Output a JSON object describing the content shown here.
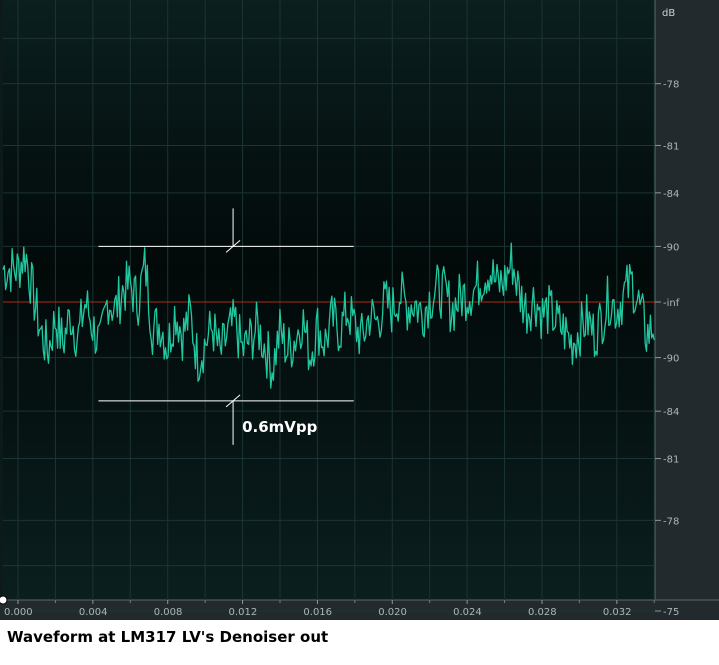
{
  "caption": "Waveform at LM317 LV's Denoiser out",
  "colors": {
    "background_top": "#071616",
    "background_mid": "#020808",
    "grid": "#1c3434",
    "waveform": "#20c8a0",
    "center_line": "#b02818",
    "annotation": "#ffffff",
    "tick_text": "#a8b8b8"
  },
  "chart_data": {
    "type": "line",
    "title": "",
    "xlabel": "",
    "ylabel": "",
    "x_unit": "s",
    "y_unit": "dB",
    "xlim": [
      0,
      0.0342
    ],
    "x_ticks": [
      0.0,
      0.004,
      0.008,
      0.012,
      0.016,
      0.02,
      0.024,
      0.028,
      0.032
    ],
    "x_tick_labels": [
      "0.000",
      "0.004",
      "0.008",
      "0.012",
      "0.016",
      "0.020",
      "0.024",
      "0.028",
      "0.032"
    ],
    "y_unit_label": "dB",
    "y_ticks": [
      {
        "label": "-75",
        "amplitude": 0.75
      },
      {
        "label": "-78",
        "amplitude": 0.53
      },
      {
        "label": "-81",
        "amplitude": 0.38
      },
      {
        "label": "-84",
        "amplitude": 0.265
      },
      {
        "label": "-90",
        "amplitude": 0.135
      },
      {
        "label": "-inf",
        "amplitude": 0
      },
      {
        "label": "-90",
        "amplitude": -0.135
      },
      {
        "label": "-84",
        "amplitude": -0.265
      },
      {
        "label": "-81",
        "amplitude": -0.38
      },
      {
        "label": "-78",
        "amplitude": -0.53
      },
      {
        "label": "-75",
        "amplitude": -0.75
      }
    ],
    "grid": true,
    "series": [
      {
        "points": [
          [
            0.0,
            0.08
          ],
          [
            0.0004,
            0.12
          ],
          [
            0.0008,
            0.02
          ],
          [
            0.0012,
            -0.07
          ],
          [
            0.0016,
            -0.12
          ],
          [
            0.002,
            -0.04
          ],
          [
            0.0024,
            -0.1
          ],
          [
            0.0028,
            -0.03
          ],
          [
            0.0032,
            -0.09
          ],
          [
            0.0036,
            0.0
          ],
          [
            0.004,
            -0.06
          ],
          [
            0.0044,
            -0.11
          ],
          [
            0.0048,
            0.01
          ],
          [
            0.0052,
            -0.02
          ],
          [
            0.0056,
            0.03
          ],
          [
            0.006,
            0.04
          ],
          [
            0.0064,
            0.0
          ],
          [
            0.0068,
            0.09
          ],
          [
            0.0072,
            -0.07
          ],
          [
            0.0076,
            -0.05
          ],
          [
            0.008,
            -0.11
          ],
          [
            0.0084,
            -0.02
          ],
          [
            0.0088,
            -0.08
          ],
          [
            0.0092,
            -0.03
          ],
          [
            0.0096,
            -0.14
          ],
          [
            0.01,
            -0.1
          ],
          [
            0.0104,
            -0.06
          ],
          [
            0.0108,
            -0.13
          ],
          [
            0.0112,
            -0.08
          ],
          [
            0.0116,
            -0.05
          ],
          [
            0.012,
            -0.12
          ],
          [
            0.0124,
            -0.09
          ],
          [
            0.0128,
            -0.06
          ],
          [
            0.0132,
            -0.11
          ],
          [
            0.0136,
            -0.16
          ],
          [
            0.014,
            -0.07
          ],
          [
            0.0144,
            -0.12
          ],
          [
            0.0148,
            -0.09
          ],
          [
            0.0152,
            -0.04
          ],
          [
            0.0156,
            -0.13
          ],
          [
            0.016,
            -0.06
          ],
          [
            0.0164,
            -0.1
          ],
          [
            0.0168,
            -0.04
          ],
          [
            0.0172,
            -0.07
          ],
          [
            0.0176,
            -0.02
          ],
          [
            0.018,
            -0.06
          ],
          [
            0.0184,
            -0.09
          ],
          [
            0.0188,
            -0.03
          ],
          [
            0.0192,
            -0.05
          ],
          [
            0.0196,
            0.0
          ],
          [
            0.02,
            -0.02
          ],
          [
            0.0204,
            0.02
          ],
          [
            0.0208,
            -0.01
          ],
          [
            0.0212,
            0.0
          ],
          [
            0.0216,
            -0.03
          ],
          [
            0.022,
            0.01
          ],
          [
            0.0224,
            0.03
          ],
          [
            0.0228,
            0.02
          ],
          [
            0.0232,
            -0.02
          ],
          [
            0.0236,
            0.01
          ],
          [
            0.024,
            0.02
          ],
          [
            0.0244,
            0.03
          ],
          [
            0.0248,
            0.06
          ],
          [
            0.0252,
            0.08
          ],
          [
            0.0256,
            0.04
          ],
          [
            0.026,
            0.05
          ],
          [
            0.0264,
            0.1
          ],
          [
            0.0268,
            0.02
          ],
          [
            0.0272,
            -0.02
          ],
          [
            0.0276,
            0.01
          ],
          [
            0.028,
            -0.03
          ],
          [
            0.0284,
            -0.02
          ],
          [
            0.0288,
            -0.05
          ],
          [
            0.0292,
            -0.07
          ],
          [
            0.0296,
            -0.1
          ],
          [
            0.03,
            -0.07
          ],
          [
            0.0304,
            -0.04
          ],
          [
            0.0308,
            -0.08
          ],
          [
            0.0312,
            -0.04
          ],
          [
            0.0316,
            0.01
          ],
          [
            0.032,
            -0.02
          ],
          [
            0.0324,
            0.02
          ],
          [
            0.0328,
            0.05
          ],
          [
            0.0332,
            -0.01
          ],
          [
            0.0336,
            -0.08
          ],
          [
            0.034,
            -0.06
          ]
        ]
      }
    ],
    "annotations": [
      {
        "text": "0.6mVpp",
        "top_level": 0.135,
        "bottom_level": -0.24,
        "x_start": 0.0051,
        "x_end": 0.0173,
        "marker_x": 0.0116
      }
    ]
  }
}
